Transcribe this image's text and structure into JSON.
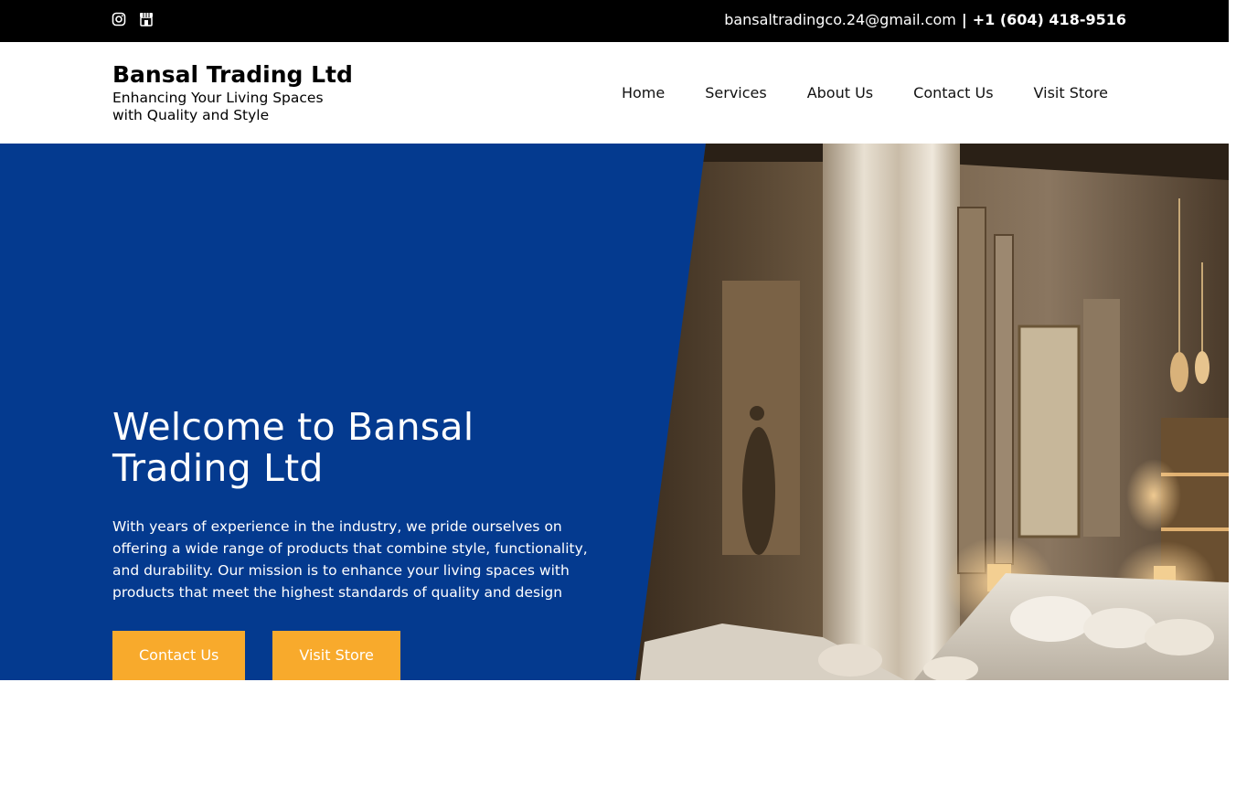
{
  "topbar": {
    "socials": [
      {
        "icon": "instagram-icon"
      },
      {
        "icon": "store-icon"
      }
    ],
    "email": "bansaltradingco.24@gmail.com",
    "separator": "|",
    "phone": "+1 (604) 418-9516"
  },
  "header": {
    "brand_name": "Bansal Trading Ltd",
    "tagline": "Enhancing Your Living Spaces with Quality and Style",
    "nav": [
      {
        "label": "Home"
      },
      {
        "label": "Services"
      },
      {
        "label": "About Us"
      },
      {
        "label": "Contact Us"
      },
      {
        "label": "Visit Store"
      }
    ]
  },
  "hero": {
    "title": "Welcome to Bansal Trading Ltd",
    "text": "With years of experience in the industry, we pride ourselves on offering a wide range of products that combine style, functionality, and durability. Our mission is to enhance your living spaces with products that meet the highest standards of quality and design",
    "buttons": [
      {
        "label": "Contact Us"
      },
      {
        "label": "Visit Store"
      }
    ]
  },
  "colors": {
    "topbar": "#000000",
    "hero_blue": "#043A8F",
    "button": "#F8AA2C"
  }
}
